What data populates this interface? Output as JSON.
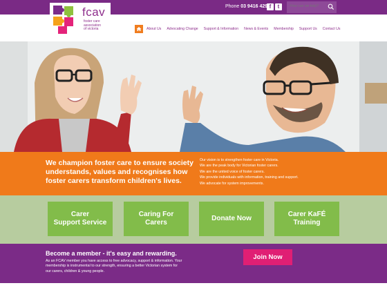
{
  "header": {
    "phone_label": "Phone",
    "phone_number": "03 9416 4292",
    "social": [
      {
        "label": "f",
        "icon": "facebook-icon"
      },
      {
        "label": "t",
        "icon": "twitter-icon"
      }
    ],
    "search": {
      "placeholder": "How can we help?"
    }
  },
  "logo": {
    "word": "fcav",
    "subtitle_lines": [
      "foster care",
      "association",
      "of victoria"
    ]
  },
  "nav": {
    "items": [
      "About Us",
      "Advocating Change",
      "Support & Information",
      "News & Events",
      "Membership",
      "Support Us",
      "Contact Us"
    ]
  },
  "banner": {
    "tagline": "We champion foster care to ensure society understands, values and recognises how foster carers transform children's lives.",
    "vision": [
      "Our vision is to strengthen foster care in Victoria.",
      "We are the peak body for Victorian foster carers.",
      "We are the united voice of foster carers.",
      "We provide individuals with information, training and support.",
      "We advocate for system improvements."
    ]
  },
  "tiles": [
    {
      "line1": "Carer",
      "line2": "Support Service"
    },
    {
      "line1": "Caring For",
      "line2": "Carers"
    },
    {
      "line1": "Donate Now",
      "line2": ""
    },
    {
      "line1": "Carer KaFÉ",
      "line2": "Training"
    }
  ],
  "member": {
    "title": "Become a member - it's easy and rewarding.",
    "text": "As an FCAV member you have access to free advocacy, support & information. Your membership is instrumental to our strength, ensuring a better Victorian system for our carers, children & young people.",
    "join_label": "Join Now"
  },
  "colors": {
    "purple": "#7a2a85",
    "orange": "#f07a1a",
    "green": "#82bc4a",
    "pink": "#e01f74"
  }
}
